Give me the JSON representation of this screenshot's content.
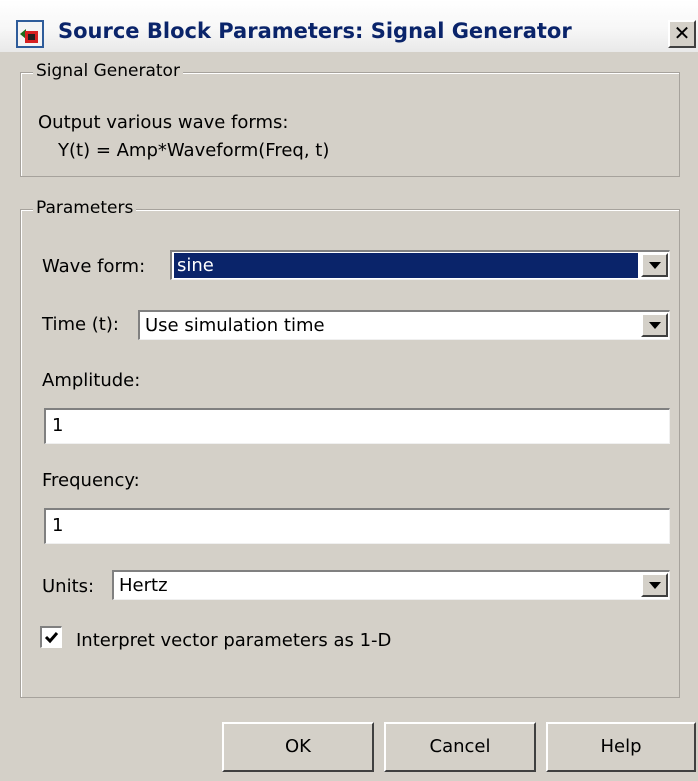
{
  "window": {
    "title": "Source Block Parameters: Signal Generator",
    "close_glyph": "✕"
  },
  "description_group": {
    "legend": "Signal Generator",
    "line1": "Output various wave forms:",
    "line2": "Y(t) = Amp*Waveform(Freq, t)"
  },
  "parameters_group": {
    "legend": "Parameters",
    "wave_form": {
      "label": "Wave form:",
      "value": "sine"
    },
    "time": {
      "label": "Time (t):",
      "value": "Use simulation time"
    },
    "amplitude": {
      "label": "Amplitude:",
      "value": "1"
    },
    "frequency": {
      "label": "Frequency:",
      "value": "1"
    },
    "units": {
      "label": "Units:",
      "value": "Hertz"
    },
    "interpret_vector": {
      "label": "Interpret vector parameters as 1-D",
      "checked": true
    }
  },
  "buttons": {
    "ok": "OK",
    "cancel": "Cancel",
    "help": "Help"
  },
  "icons": {
    "app": "simulink-block-icon",
    "close": "close-icon",
    "dropdown": "chevron-down-icon",
    "check": "check-icon"
  },
  "colors": {
    "title_text": "#0a246a",
    "selection": "#0a246a",
    "face": "#d4d0c8"
  }
}
